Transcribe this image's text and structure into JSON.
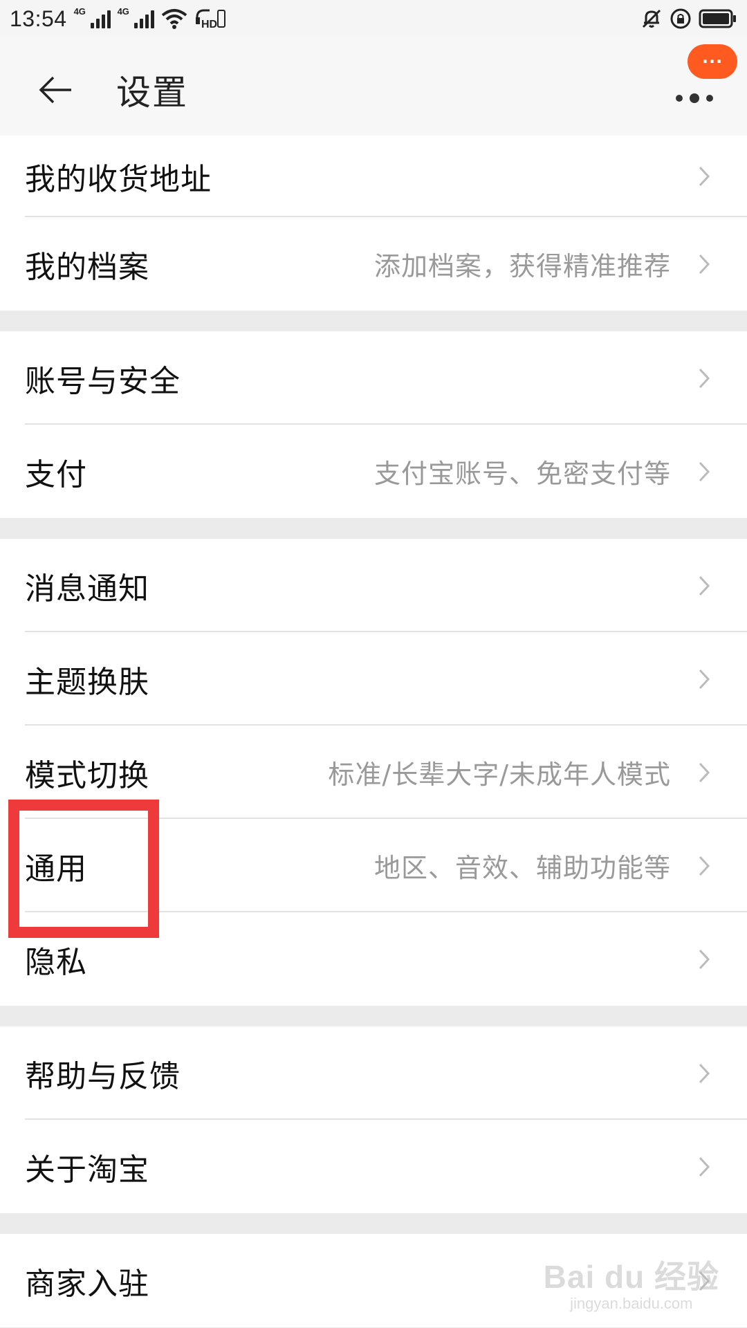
{
  "status_bar": {
    "time": "13:54",
    "signal1_label": "4G",
    "signal2_label": "4G",
    "hd_label": "HD",
    "icons": [
      "signal-icon",
      "wifi-icon",
      "hd-icon",
      "bell-off-icon",
      "rotation-lock-icon",
      "battery-icon"
    ]
  },
  "header": {
    "title": "设置",
    "badge": "···"
  },
  "groups": [
    {
      "items": [
        {
          "label": "我的收货地址",
          "hint": ""
        },
        {
          "label": "我的档案",
          "hint": "添加档案，获得精准推荐"
        }
      ]
    },
    {
      "items": [
        {
          "label": "账号与安全",
          "hint": ""
        },
        {
          "label": "支付",
          "hint": "支付宝账号、免密支付等"
        }
      ]
    },
    {
      "items": [
        {
          "label": "消息通知",
          "hint": ""
        },
        {
          "label": "主题换肤",
          "hint": ""
        },
        {
          "label": "模式切换",
          "hint": "标准/长辈大字/未成年人模式"
        },
        {
          "label": "通用",
          "hint": "地区、音效、辅助功能等"
        },
        {
          "label": "隐私",
          "hint": ""
        }
      ]
    },
    {
      "items": [
        {
          "label": "帮助与反馈",
          "hint": ""
        },
        {
          "label": "关于淘宝",
          "hint": ""
        }
      ]
    },
    {
      "items": [
        {
          "label": "商家入驻",
          "hint": ""
        }
      ]
    }
  ],
  "watermark": {
    "logo": "Bai du 经验",
    "url": "jingyan.baidu.com"
  },
  "colors": {
    "accent": "#ff5a1f",
    "highlight": "#ee3a3a",
    "hint_text": "#999999",
    "background": "#ebebeb"
  }
}
